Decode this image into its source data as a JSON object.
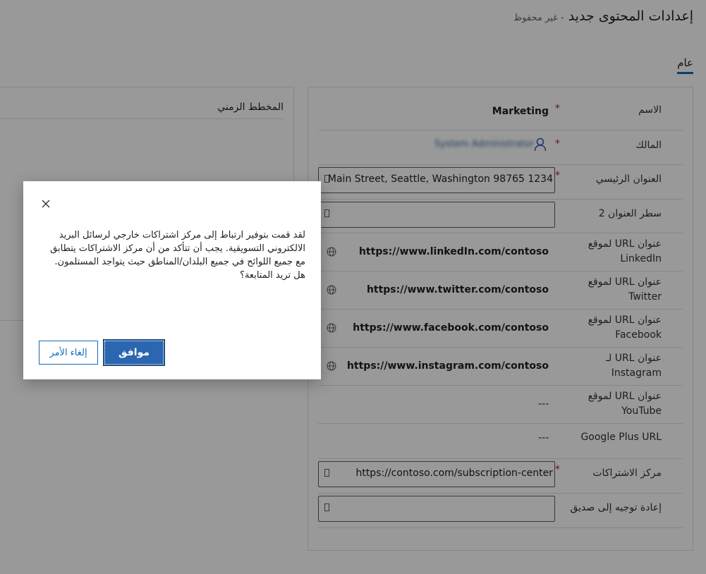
{
  "header": {
    "title": "إعدادات المحتوى جديد",
    "status": "- غير محفوظ"
  },
  "tabs": [
    {
      "label": "عام"
    }
  ],
  "timeline": {
    "title": "المخطط الزمني"
  },
  "general": {
    "name": {
      "label": "الاسم",
      "value": "Marketing"
    },
    "owner": {
      "label": "المالك",
      "value": "System Administrator"
    },
    "main_address": {
      "label": "العنوان الرئيسي",
      "value": "Main Street, Seattle, Washington 98765 1234"
    },
    "address_line2": {
      "label": "سطر العنوان 2",
      "value": ""
    },
    "linkedin": {
      "label": "عنوان URL لموقع LinkedIn",
      "value": "https://www.linkedIn.com/contoso"
    },
    "twitter": {
      "label": "عنوان URL لموقع Twitter",
      "value": "https://www.twitter.com/contoso"
    },
    "facebook": {
      "label": "عنوان URL لموقع Facebook",
      "value": "https://www.facebook.com/contoso"
    },
    "instagram": {
      "label": "عنوان URL لـ Instagram",
      "value": "https://www.instagram.com/contoso"
    },
    "youtube": {
      "label": "عنوان URL لموقع YouTube",
      "value": "---"
    },
    "googleplus": {
      "label": "Google Plus URL",
      "value": "---"
    },
    "subscription_center": {
      "label": "مركز الاشتراكات",
      "value": "https://contoso.com/subscription-center"
    },
    "forward_to_friend": {
      "label": "إعادة توجيه إلى صديق",
      "value": ""
    },
    "required_marker": "*"
  },
  "dialog": {
    "message": "لقد قمت بتوفير ارتباط إلى مركز اشتراكات خارجي لرسائل البريد الالكتروني التسويقية. يجب أن تتأكد من أن مركز الاشتراكات يتطابق مع جميع اللوائح في جميع البلدان/المناطق حيث يتواجد المستلمون. هل تريد المتابعة؟",
    "ok_label": "موافق",
    "cancel_label": "إلغاء الأمر"
  }
}
